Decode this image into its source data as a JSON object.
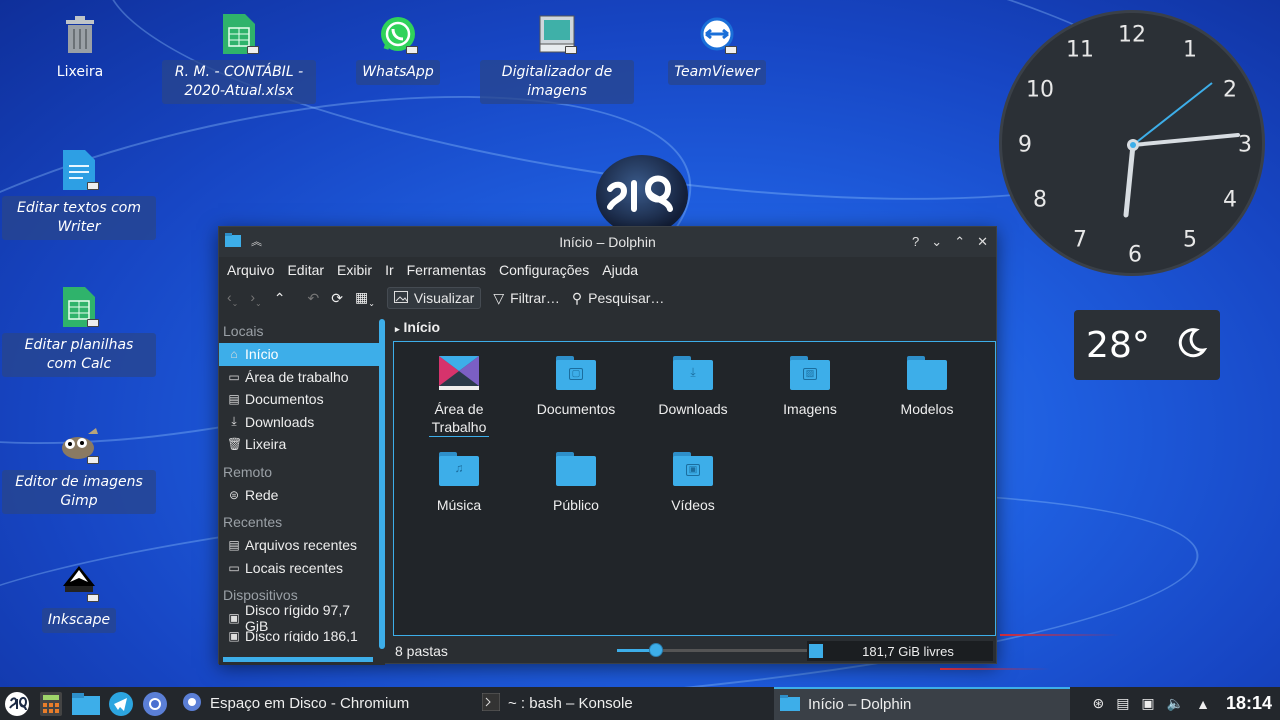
{
  "desktop": {
    "icons": [
      {
        "label": "Lixeira"
      },
      {
        "label": "R. M. - CONTÁBIL - 2020-Atual.xlsx"
      },
      {
        "label": "WhatsApp"
      },
      {
        "label": "Digitalizador de imagens"
      },
      {
        "label": "TeamViewer"
      },
      {
        "label": "Editar textos com Writer"
      },
      {
        "label": "Editar planilhas com Calc"
      },
      {
        "label": "Editor de imagens Gimp"
      },
      {
        "label": "Inkscape"
      }
    ]
  },
  "clock": {
    "numbers": [
      "12",
      "1",
      "2",
      "3",
      "4",
      "5",
      "6",
      "7",
      "8",
      "9",
      "10",
      "11"
    ],
    "time": "18:14"
  },
  "weather": {
    "temperature": "28°",
    "icon": "moon-icon"
  },
  "window": {
    "title": "Início – Dolphin",
    "controls": [
      "?",
      "⌄",
      "⌃",
      "✕"
    ],
    "menu": [
      "Arquivo",
      "Editar",
      "Exibir",
      "Ir",
      "Ferramentas",
      "Configurações",
      "Ajuda"
    ],
    "toolbar": {
      "view": "Visualizar",
      "filter": "Filtrar…",
      "search": "Pesquisar…"
    },
    "sidebar": {
      "sections": [
        {
          "title": "Locais",
          "items": [
            {
              "label": "Início",
              "icon": "home-icon",
              "active": true
            },
            {
              "label": "Área de trabalho",
              "icon": "desktop-icon"
            },
            {
              "label": "Documentos",
              "icon": "document-icon"
            },
            {
              "label": "Downloads",
              "icon": "download-icon"
            },
            {
              "label": "Lixeira",
              "icon": "trash-icon"
            }
          ]
        },
        {
          "title": "Remoto",
          "items": [
            {
              "label": "Rede",
              "icon": "network-icon"
            }
          ]
        },
        {
          "title": "Recentes",
          "items": [
            {
              "label": "Arquivos recentes",
              "icon": "recent-files-icon"
            },
            {
              "label": "Locais recentes",
              "icon": "recent-places-icon"
            }
          ]
        },
        {
          "title": "Dispositivos",
          "items": [
            {
              "label": "Disco rígido 97,7 GiB",
              "icon": "drive-icon"
            },
            {
              "label": "Disco rígido 186,1",
              "icon": "drive-icon"
            }
          ]
        }
      ]
    },
    "breadcrumb": "Início",
    "files": [
      {
        "label": "Área de Trabalho",
        "kind": "desktop"
      },
      {
        "label": "Documentos",
        "kind": "documents"
      },
      {
        "label": "Downloads",
        "kind": "downloads"
      },
      {
        "label": "Imagens",
        "kind": "pictures"
      },
      {
        "label": "Modelos",
        "kind": "templates"
      },
      {
        "label": "Música",
        "kind": "music"
      },
      {
        "label": "Público",
        "kind": "public"
      },
      {
        "label": "Vídeos",
        "kind": "videos"
      }
    ],
    "status": {
      "count": "8 pastas",
      "free": "181,7 GiB livres"
    }
  },
  "taskbar": {
    "tasks": [
      {
        "label": "Espaço em Disco - Chromium"
      },
      {
        "label": "~ : bash – Konsole"
      },
      {
        "label": "Início – Dolphin"
      }
    ],
    "time": "18:14"
  },
  "colors": {
    "accent": "#3daee9",
    "window_bg": "#2a2e32",
    "taskbar_bg": "#23272c"
  }
}
